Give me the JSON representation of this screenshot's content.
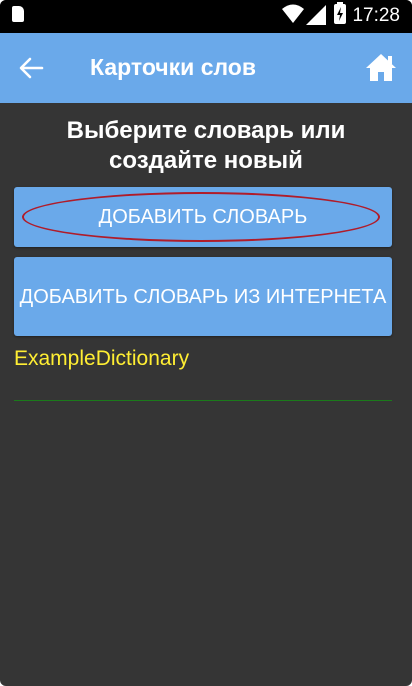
{
  "status_bar": {
    "time": "17:28",
    "icons": [
      "sim-card-icon",
      "wifi-icon",
      "cellular-signal-icon",
      "battery-charging-icon"
    ]
  },
  "app_bar": {
    "title": "Карточки слов",
    "back_icon": "arrow-left-icon",
    "home_icon": "home-icon",
    "background_color": "#6aa9ea"
  },
  "main": {
    "heading": "Выберите словарь или создайте новый",
    "buttons": [
      {
        "label": "ДОБАВИТЬ СЛОВАРЬ"
      },
      {
        "label": "ДОБАВИТЬ СЛОВАРЬ ИЗ ИНТЕРНЕТА"
      }
    ],
    "dictionaries": [
      {
        "name": "ExampleDictionary"
      }
    ]
  },
  "colors": {
    "background": "#353535",
    "accent": "#6aa9ea",
    "dictionary_text": "#ffee33",
    "highlight_ellipse": "#b01c2a",
    "divider": "#1a7a1a"
  }
}
